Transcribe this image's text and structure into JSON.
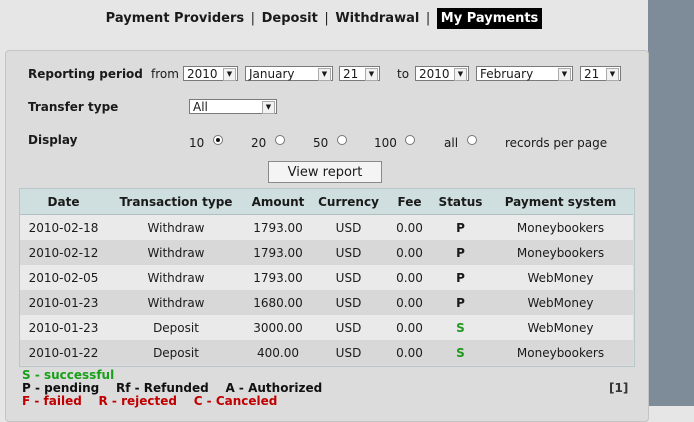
{
  "nav": {
    "items": [
      "Payment Providers",
      "Deposit",
      "Withdrawal",
      "My Payments"
    ],
    "separator": "|",
    "active_index": 3
  },
  "form": {
    "reporting_period_label": "Reporting period",
    "from_label": "from",
    "to_label": "to",
    "from_year": "2010",
    "from_month": "January",
    "from_day": "21",
    "to_year": "2010",
    "to_month": "February",
    "to_day": "21",
    "transfer_type_label": "Transfer type",
    "transfer_type_value": "All",
    "display_label": "Display",
    "display_options": [
      "10",
      "20",
      "50",
      "100",
      "all"
    ],
    "display_selected": "10",
    "records_suffix": "records per page",
    "view_report_label": "View report"
  },
  "table": {
    "headers": [
      "Date",
      "Transaction type",
      "Amount",
      "Currency",
      "Fee",
      "Status",
      "Payment system"
    ],
    "rows": [
      [
        "2010-02-18",
        "Withdraw",
        "1793.00",
        "USD",
        "0.00",
        "P",
        "Moneybookers"
      ],
      [
        "2010-02-12",
        "Withdraw",
        "1793.00",
        "USD",
        "0.00",
        "P",
        "Moneybookers"
      ],
      [
        "2010-02-05",
        "Withdraw",
        "1793.00",
        "USD",
        "0.00",
        "P",
        "WebMoney"
      ],
      [
        "2010-01-23",
        "Withdraw",
        "1680.00",
        "USD",
        "0.00",
        "P",
        "WebMoney"
      ],
      [
        "2010-01-23",
        "Deposit",
        "3000.00",
        "USD",
        "0.00",
        "S",
        "WebMoney"
      ],
      [
        "2010-01-22",
        "Deposit",
        "400.00",
        "USD",
        "0.00",
        "S",
        "Moneybookers"
      ]
    ]
  },
  "legend": {
    "line1": "S - successful",
    "line2": "P - pending    Rf - Refunded    A - Authorized",
    "line3": "F - failed    R - rejected    C - Canceled"
  },
  "pager": "[1]",
  "colors": {
    "success": "#1f9a1f",
    "failed": "#c00000",
    "header_bg": "#cfdede",
    "active_nav_bg": "#000000"
  }
}
